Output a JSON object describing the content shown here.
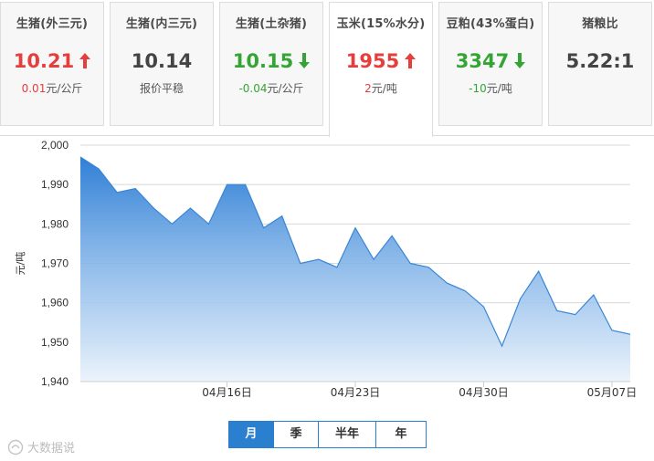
{
  "cards": [
    {
      "title": "生猪(外三元)",
      "value": "10.21",
      "trend": "up",
      "change_num": "0.01",
      "change_unit": "元/公斤"
    },
    {
      "title": "生猪(内三元)",
      "value": "10.14",
      "trend": "flat",
      "change_num": "",
      "change_unit": "报价平稳"
    },
    {
      "title": "生猪(土杂猪)",
      "value": "10.15",
      "trend": "down",
      "change_num": "-0.04",
      "change_unit": "元/公斤"
    },
    {
      "title": "玉米(15%水分)",
      "value": "1955",
      "trend": "up",
      "change_num": "2",
      "change_unit": "元/吨"
    },
    {
      "title": "豆粕(43%蛋白)",
      "value": "3347",
      "trend": "down",
      "change_num": "-10",
      "change_unit": "元/吨"
    },
    {
      "title": "猪粮比",
      "value": "5.22:1",
      "trend": "none",
      "change_num": "",
      "change_unit": ""
    }
  ],
  "active_card": 3,
  "colors": {
    "up": "#e63d3d",
    "down": "#34a534",
    "accent": "#2a7fcf",
    "line": "#3a86d4"
  },
  "chart_data": {
    "type": "area",
    "title": "",
    "xlabel": "",
    "ylabel": "元/吨",
    "ylim": [
      1940,
      2000
    ],
    "yticks": [
      "1,940",
      "1,950",
      "1,960",
      "1,970",
      "1,980",
      "1,990",
      "2,000"
    ],
    "ytick_values": [
      1940,
      1950,
      1960,
      1970,
      1980,
      1990,
      2000
    ],
    "xtick_labels": [
      "04月16日",
      "04月23日",
      "04月30日",
      "05月07日"
    ],
    "xtick_index": [
      8,
      15,
      22,
      29
    ],
    "grid": true,
    "series": [
      {
        "values": [
          1997,
          1994,
          1988,
          1989,
          1984,
          1980,
          1984,
          1980,
          1990,
          1990,
          1979,
          1982,
          1970,
          1971,
          1969,
          1979,
          1971,
          1977,
          1970,
          1969,
          1965,
          1963,
          1959,
          1949,
          1961,
          1968,
          1958,
          1957,
          1962,
          1953,
          1952
        ]
      }
    ]
  },
  "range_tabs": [
    "月",
    "季",
    "半年",
    "年"
  ],
  "active_range": 0,
  "watermark": "大数据说"
}
